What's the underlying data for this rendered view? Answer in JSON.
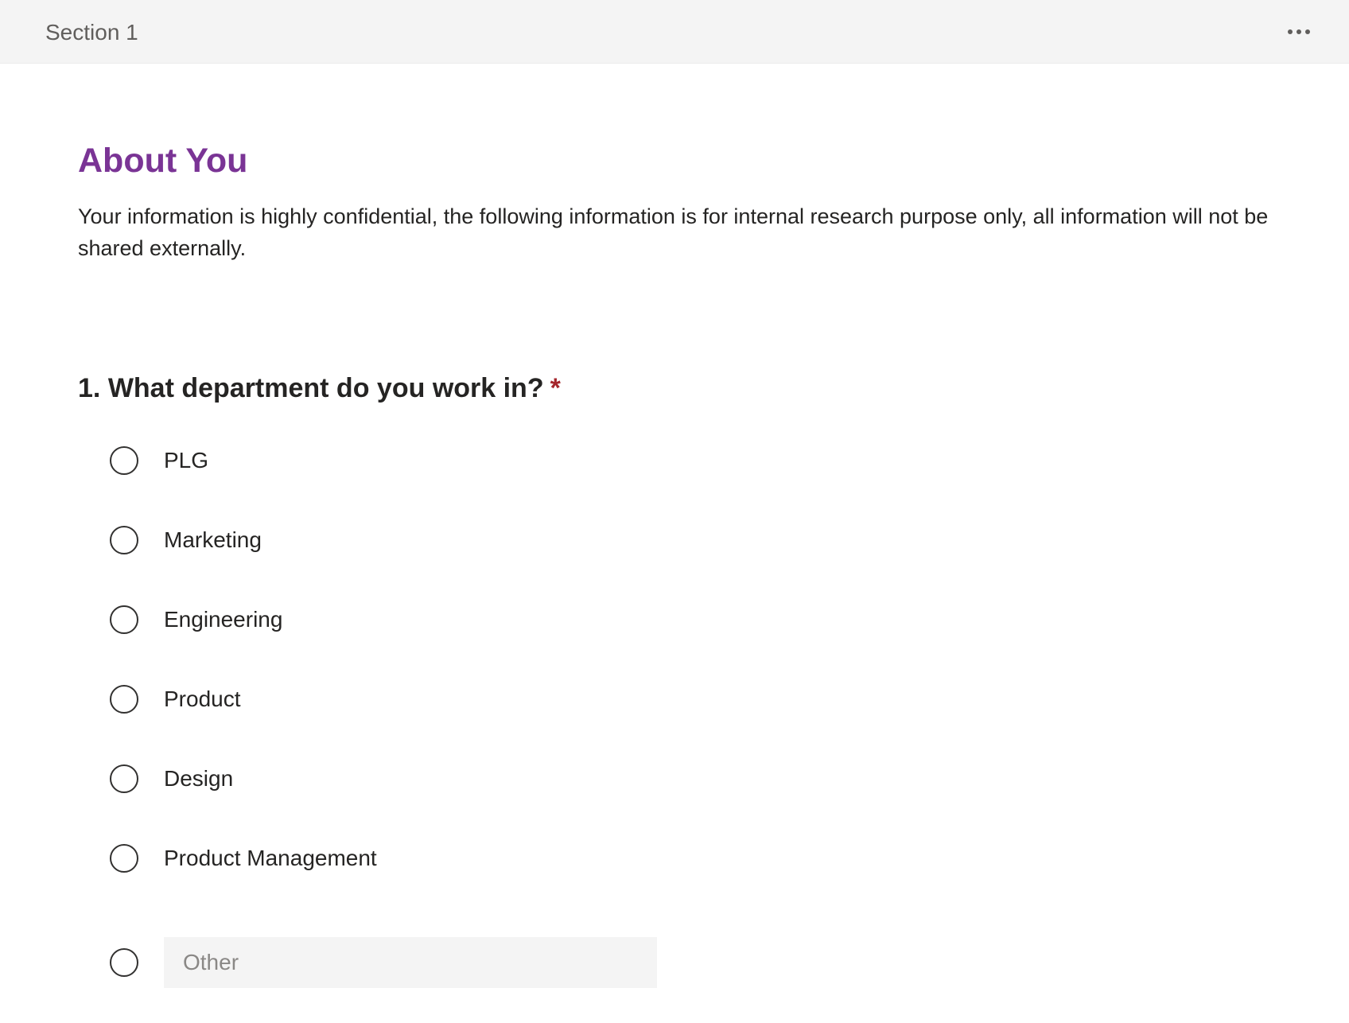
{
  "section": {
    "title": "Section 1",
    "more_icon": "more-horizontal-icon"
  },
  "form": {
    "title": "About You",
    "description": "Your information is highly confidential, the following information is for internal research purpose only, all information will not be shared externally.",
    "accent_color": "#7a3495"
  },
  "question": {
    "number": "1.",
    "text": "What department do you work in?",
    "required_mark": "*",
    "required_color": "#a4262c",
    "options": [
      {
        "label": "PLG"
      },
      {
        "label": "Marketing"
      },
      {
        "label": "Engineering"
      },
      {
        "label": "Product"
      },
      {
        "label": "Design"
      },
      {
        "label": "Product Management"
      }
    ],
    "other_placeholder": "Other"
  }
}
